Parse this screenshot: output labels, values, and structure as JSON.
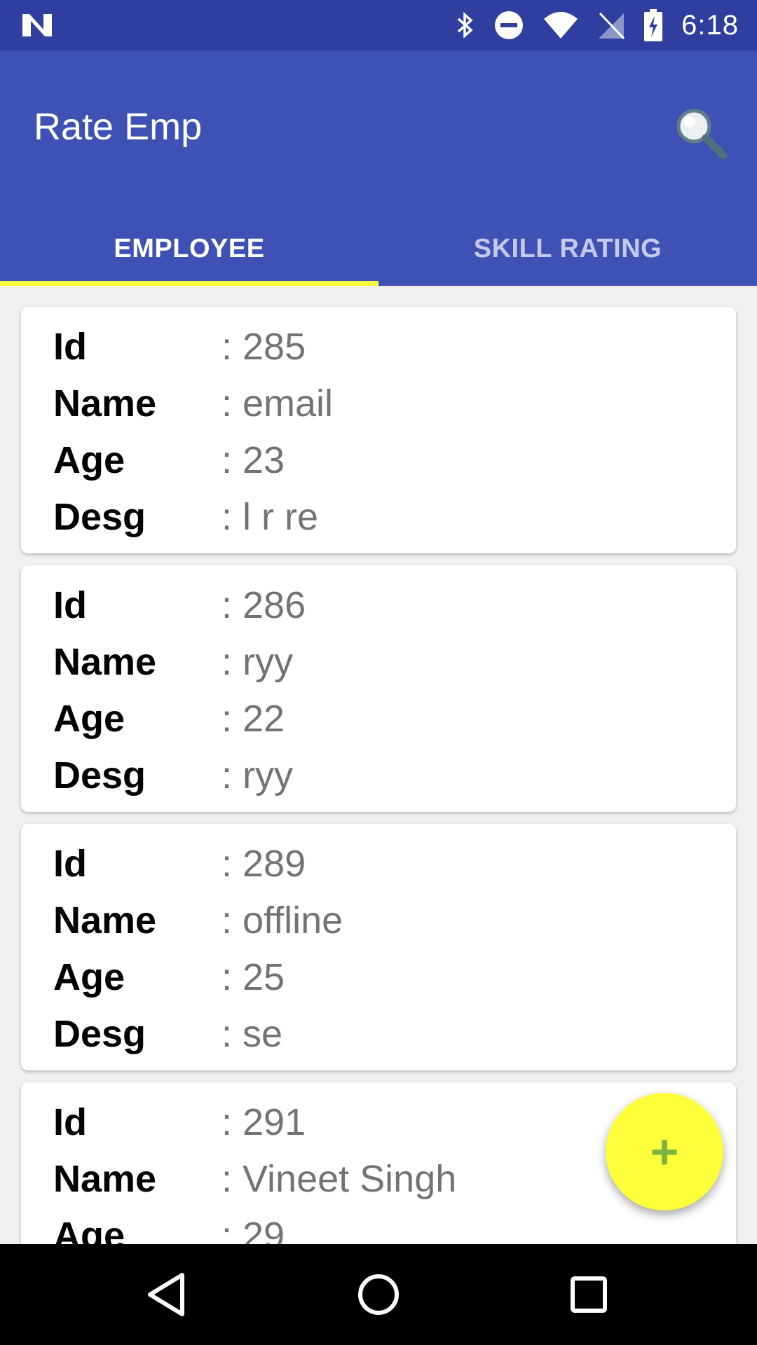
{
  "status_bar": {
    "time": "6:18",
    "icons": [
      "notification-n-icon",
      "bluetooth-icon",
      "do-not-disturb-icon",
      "wifi-icon",
      "no-signal-icon",
      "battery-charging-icon"
    ]
  },
  "app_bar": {
    "title": "Rate Emp",
    "search_icon": "search-icon",
    "tabs": [
      {
        "label": "EMPLOYEE",
        "active": true
      },
      {
        "label": "SKILL RATING",
        "active": false
      }
    ]
  },
  "labels": {
    "id": "Id",
    "name": "Name",
    "age": "Age",
    "desg": "Desg"
  },
  "employees": [
    {
      "id": ": 285",
      "name": ": email",
      "age": ": 23",
      "desg": ": l r re"
    },
    {
      "id": ": 286",
      "name": ": ryy",
      "age": ": 22",
      "desg": ": ryy"
    },
    {
      "id": ": 289",
      "name": ": offline",
      "age": ": 25",
      "desg": ": se"
    },
    {
      "id": ": 291",
      "name": ": Vineet Singh",
      "age": ": 29",
      "desg": ""
    }
  ],
  "fab": {
    "label": "+",
    "icon": "add-icon"
  },
  "nav_bar": {
    "icons": [
      "back-icon",
      "home-icon",
      "recents-icon"
    ]
  },
  "colors": {
    "primary": "#3f51b5",
    "primary_dark": "#303f9f",
    "accent": "#ffff3b",
    "fab_plus": "#7cb342"
  }
}
